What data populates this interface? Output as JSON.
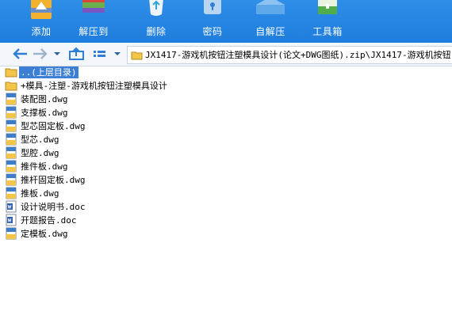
{
  "toolbar": {
    "buttons": [
      {
        "label": "添加",
        "icon": "add-archive-icon"
      },
      {
        "label": "解压到",
        "icon": "extract-to-icon"
      },
      {
        "label": "删除",
        "icon": "delete-icon"
      },
      {
        "label": "密码",
        "icon": "password-icon"
      },
      {
        "label": "自解压",
        "icon": "self-extract-icon"
      },
      {
        "label": "工具箱",
        "icon": "toolbox-icon"
      }
    ]
  },
  "address": {
    "path": "JX1417-游戏机按钮注塑模具设计(论文+DWG图纸).zip\\JX1417-游戏机按钮"
  },
  "files": [
    {
      "name": "..(上层目录)",
      "type": "up"
    },
    {
      "name": "+模具-注塑-游戏机按钮注塑模具设计",
      "type": "folder"
    },
    {
      "name": "装配图.dwg",
      "type": "dwg"
    },
    {
      "name": "支撑板.dwg",
      "type": "dwg"
    },
    {
      "name": "型芯固定板.dwg",
      "type": "dwg"
    },
    {
      "name": "型芯.dwg",
      "type": "dwg"
    },
    {
      "name": "型腔.dwg",
      "type": "dwg"
    },
    {
      "name": "推件板.dwg",
      "type": "dwg"
    },
    {
      "name": "推杆固定板.dwg",
      "type": "dwg"
    },
    {
      "name": "推板.dwg",
      "type": "dwg"
    },
    {
      "name": "设计说明书.doc",
      "type": "doc"
    },
    {
      "name": "开题报告.doc",
      "type": "doc"
    },
    {
      "name": "定模板.dwg",
      "type": "dwg"
    }
  ]
}
